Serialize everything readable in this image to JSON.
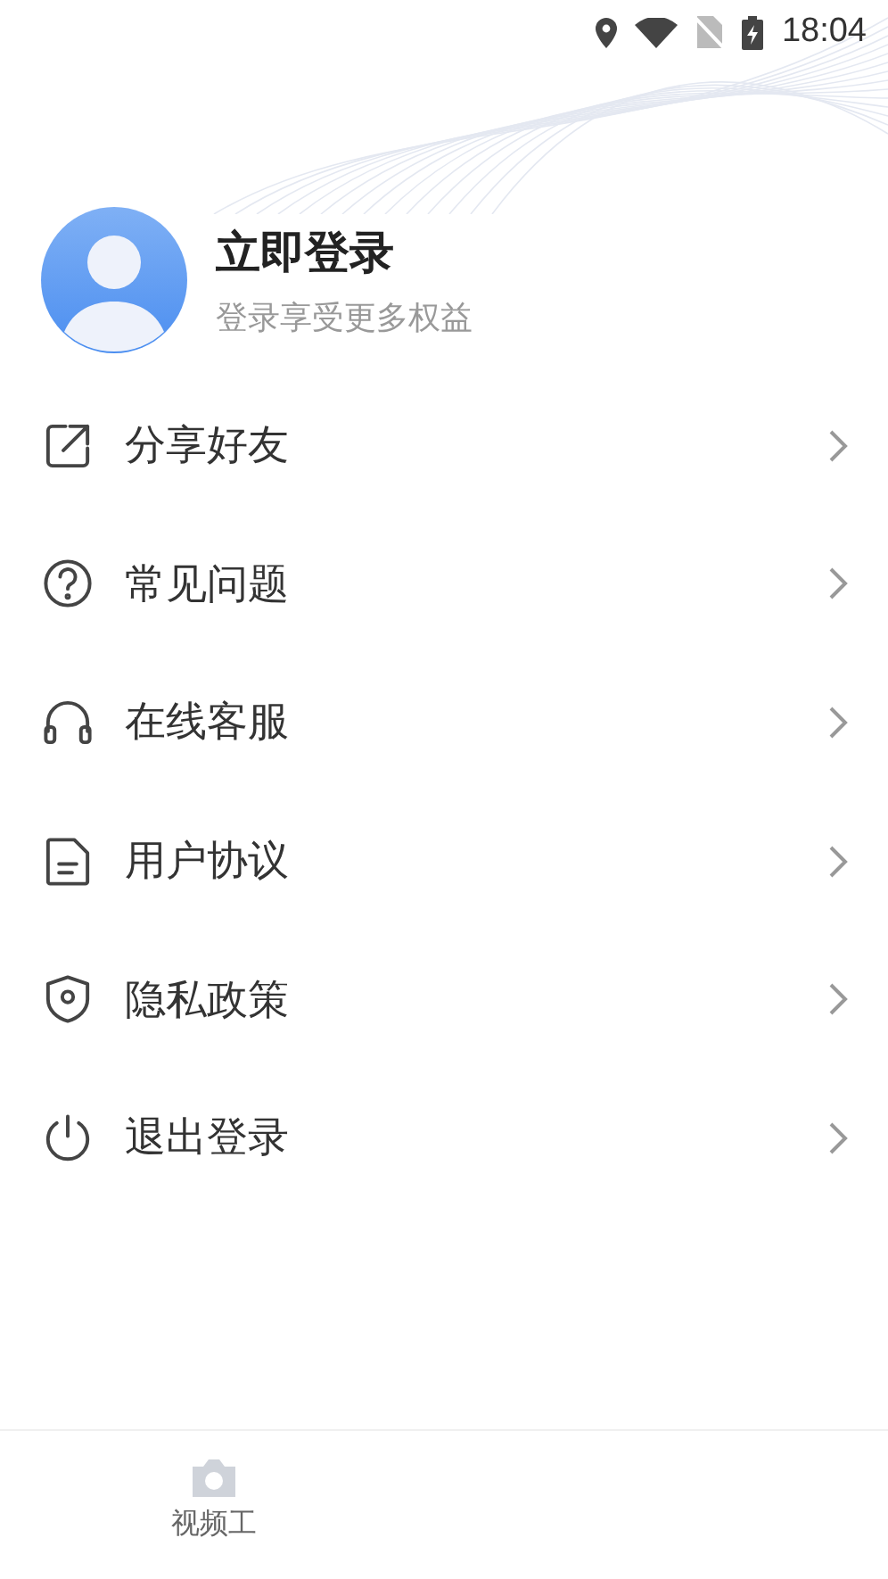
{
  "status_bar": {
    "time": "18:04"
  },
  "profile": {
    "title": "立即登录",
    "subtitle": "登录享受更多权益"
  },
  "menu": [
    {
      "kind": "share",
      "label": "分享好友"
    },
    {
      "kind": "help",
      "label": "常见问题"
    },
    {
      "kind": "service",
      "label": "在线客服"
    },
    {
      "kind": "document",
      "label": "用户协议"
    },
    {
      "kind": "privacy",
      "label": "隐私政策"
    },
    {
      "kind": "power",
      "label": "退出登录"
    }
  ],
  "bottom_nav": [
    {
      "label": "视频工"
    }
  ]
}
